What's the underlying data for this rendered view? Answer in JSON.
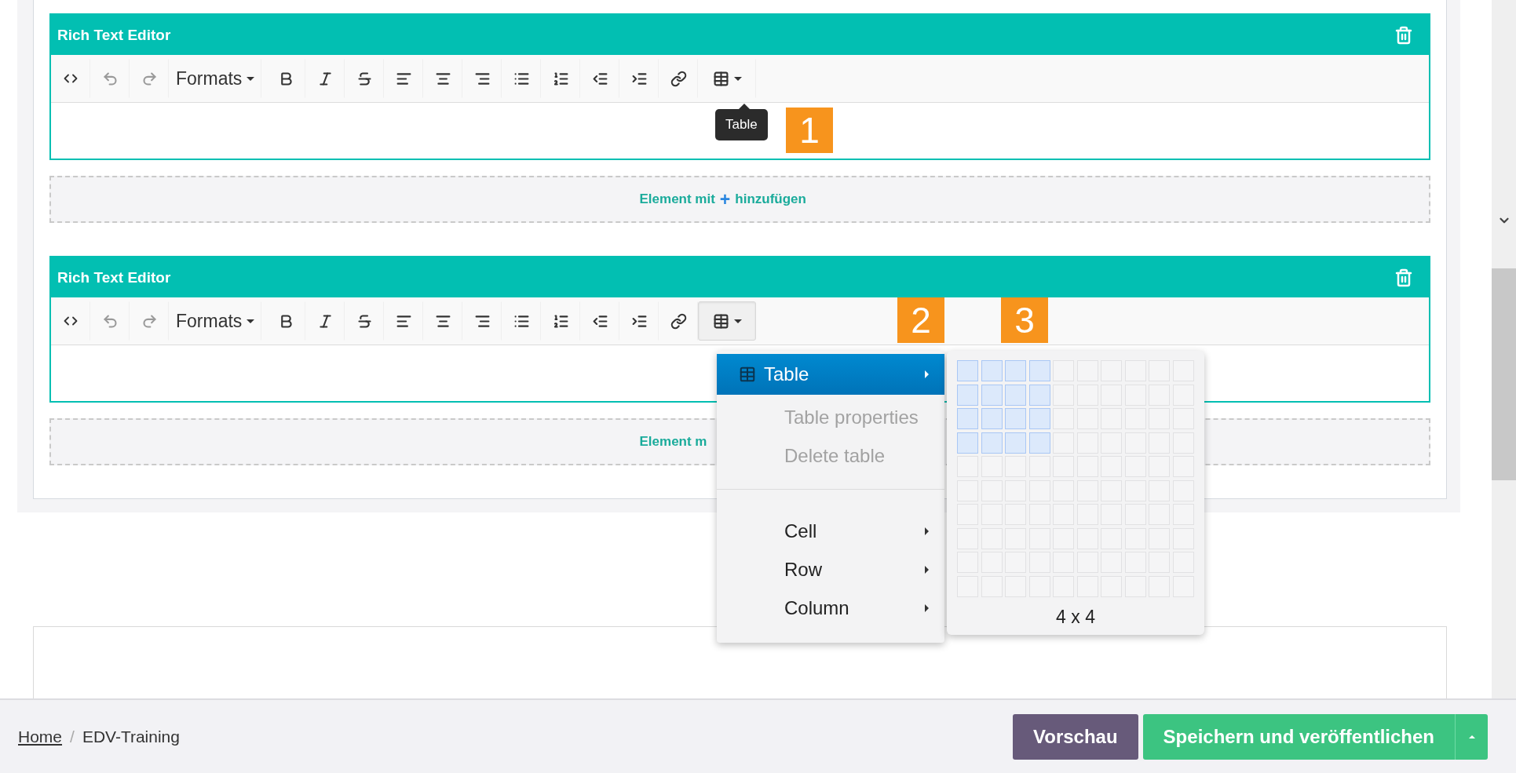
{
  "editors": [
    {
      "title": "Rich Text Editor",
      "toolbar": [
        {
          "kind": "code",
          "disabled": false,
          "pressed": false
        },
        {
          "kind": "undo",
          "disabled": true,
          "pressed": false
        },
        {
          "kind": "redo",
          "disabled": true,
          "pressed": false
        },
        {
          "kind": "formats",
          "label": "Formats",
          "disabled": false,
          "pressed": false
        },
        {
          "kind": "bold",
          "disabled": false,
          "pressed": false
        },
        {
          "kind": "italic",
          "disabled": false,
          "pressed": false
        },
        {
          "kind": "strike",
          "disabled": false,
          "pressed": false
        },
        {
          "kind": "align-left",
          "disabled": false,
          "pressed": false
        },
        {
          "kind": "align-center",
          "disabled": false,
          "pressed": false
        },
        {
          "kind": "align-right",
          "disabled": false,
          "pressed": false
        },
        {
          "kind": "bullets",
          "disabled": false,
          "pressed": false
        },
        {
          "kind": "numbers",
          "disabled": false,
          "pressed": false
        },
        {
          "kind": "outdent",
          "disabled": false,
          "pressed": false
        },
        {
          "kind": "indent",
          "disabled": false,
          "pressed": false
        },
        {
          "kind": "link",
          "disabled": false,
          "pressed": false
        },
        {
          "kind": "table",
          "disabled": false,
          "pressed": false
        }
      ],
      "tooltip": "Table",
      "markers": [
        "1"
      ],
      "add_bar": {
        "label": "Element mit",
        "plus": "+",
        "link": "hinzufügen"
      }
    },
    {
      "title": "Rich Text Editor",
      "toolbar": [
        {
          "kind": "code",
          "disabled": false,
          "pressed": false
        },
        {
          "kind": "undo",
          "disabled": true,
          "pressed": false
        },
        {
          "kind": "redo",
          "disabled": true,
          "pressed": false
        },
        {
          "kind": "formats",
          "label": "Formats",
          "disabled": false,
          "pressed": false
        },
        {
          "kind": "bold",
          "disabled": false,
          "pressed": false
        },
        {
          "kind": "italic",
          "disabled": false,
          "pressed": false
        },
        {
          "kind": "strike",
          "disabled": false,
          "pressed": false
        },
        {
          "kind": "align-left",
          "disabled": false,
          "pressed": false
        },
        {
          "kind": "align-center",
          "disabled": false,
          "pressed": false
        },
        {
          "kind": "align-right",
          "disabled": false,
          "pressed": false
        },
        {
          "kind": "bullets",
          "disabled": false,
          "pressed": false
        },
        {
          "kind": "numbers",
          "disabled": false,
          "pressed": false
        },
        {
          "kind": "outdent",
          "disabled": false,
          "pressed": false
        },
        {
          "kind": "indent",
          "disabled": false,
          "pressed": false
        },
        {
          "kind": "link",
          "disabled": false,
          "pressed": false
        },
        {
          "kind": "table",
          "disabled": false,
          "pressed": true
        }
      ],
      "markers": [
        "2",
        "3"
      ],
      "menu": {
        "items": [
          {
            "kind": "icon-item",
            "label": "Table",
            "selected": true,
            "disabled": false,
            "submenu": true
          },
          {
            "kind": "item",
            "label": "Table properties",
            "selected": false,
            "disabled": true,
            "submenu": false
          },
          {
            "kind": "item",
            "label": "Delete table",
            "selected": false,
            "disabled": true,
            "submenu": false
          },
          {
            "kind": "separator"
          },
          {
            "kind": "item",
            "label": "Cell",
            "selected": false,
            "disabled": false,
            "submenu": true
          },
          {
            "kind": "item",
            "label": "Row",
            "selected": false,
            "disabled": false,
            "submenu": true
          },
          {
            "kind": "item",
            "label": "Column",
            "selected": false,
            "disabled": false,
            "submenu": true
          }
        ],
        "grid": {
          "rows": [
            {
              "cells": [
                {
                  "selected": true
                },
                {
                  "selected": true
                },
                {
                  "selected": true
                },
                {
                  "selected": true
                },
                {
                  "selected": false
                },
                {
                  "selected": false
                },
                {
                  "selected": false
                },
                {
                  "selected": false
                },
                {
                  "selected": false
                },
                {
                  "selected": false
                }
              ]
            },
            {
              "cells": [
                {
                  "selected": true
                },
                {
                  "selected": true
                },
                {
                  "selected": true
                },
                {
                  "selected": true
                },
                {
                  "selected": false
                },
                {
                  "selected": false
                },
                {
                  "selected": false
                },
                {
                  "selected": false
                },
                {
                  "selected": false
                },
                {
                  "selected": false
                }
              ]
            },
            {
              "cells": [
                {
                  "selected": true
                },
                {
                  "selected": true
                },
                {
                  "selected": true
                },
                {
                  "selected": true
                },
                {
                  "selected": false
                },
                {
                  "selected": false
                },
                {
                  "selected": false
                },
                {
                  "selected": false
                },
                {
                  "selected": false
                },
                {
                  "selected": false
                }
              ]
            },
            {
              "cells": [
                {
                  "selected": true
                },
                {
                  "selected": true
                },
                {
                  "selected": true
                },
                {
                  "selected": true
                },
                {
                  "selected": false
                },
                {
                  "selected": false
                },
                {
                  "selected": false
                },
                {
                  "selected": false
                },
                {
                  "selected": false
                },
                {
                  "selected": false
                }
              ]
            },
            {
              "cells": [
                {
                  "selected": false
                },
                {
                  "selected": false
                },
                {
                  "selected": false
                },
                {
                  "selected": false
                },
                {
                  "selected": false
                },
                {
                  "selected": false
                },
                {
                  "selected": false
                },
                {
                  "selected": false
                },
                {
                  "selected": false
                },
                {
                  "selected": false
                }
              ]
            },
            {
              "cells": [
                {
                  "selected": false
                },
                {
                  "selected": false
                },
                {
                  "selected": false
                },
                {
                  "selected": false
                },
                {
                  "selected": false
                },
                {
                  "selected": false
                },
                {
                  "selected": false
                },
                {
                  "selected": false
                },
                {
                  "selected": false
                },
                {
                  "selected": false
                }
              ]
            },
            {
              "cells": [
                {
                  "selected": false
                },
                {
                  "selected": false
                },
                {
                  "selected": false
                },
                {
                  "selected": false
                },
                {
                  "selected": false
                },
                {
                  "selected": false
                },
                {
                  "selected": false
                },
                {
                  "selected": false
                },
                {
                  "selected": false
                },
                {
                  "selected": false
                }
              ]
            },
            {
              "cells": [
                {
                  "selected": false
                },
                {
                  "selected": false
                },
                {
                  "selected": false
                },
                {
                  "selected": false
                },
                {
                  "selected": false
                },
                {
                  "selected": false
                },
                {
                  "selected": false
                },
                {
                  "selected": false
                },
                {
                  "selected": false
                },
                {
                  "selected": false
                }
              ]
            },
            {
              "cells": [
                {
                  "selected": false
                },
                {
                  "selected": false
                },
                {
                  "selected": false
                },
                {
                  "selected": false
                },
                {
                  "selected": false
                },
                {
                  "selected": false
                },
                {
                  "selected": false
                },
                {
                  "selected": false
                },
                {
                  "selected": false
                },
                {
                  "selected": false
                }
              ]
            },
            {
              "cells": [
                {
                  "selected": false
                },
                {
                  "selected": false
                },
                {
                  "selected": false
                },
                {
                  "selected": false
                },
                {
                  "selected": false
                },
                {
                  "selected": false
                },
                {
                  "selected": false
                },
                {
                  "selected": false
                },
                {
                  "selected": false
                },
                {
                  "selected": false
                }
              ]
            }
          ],
          "size_label": "4 x 4"
        }
      },
      "add_bar": {
        "label": "Element m"
      }
    }
  ],
  "footer": {
    "breadcrumb": [
      {
        "label": "Home",
        "link": true
      },
      {
        "label": "EDV-Training",
        "link": false
      }
    ],
    "separator": "/",
    "buttons": [
      {
        "label": "Vorschau",
        "kind": "secondary",
        "split": false
      },
      {
        "label": "Speichern und veröffentlichen",
        "kind": "primary",
        "split": true
      }
    ]
  }
}
